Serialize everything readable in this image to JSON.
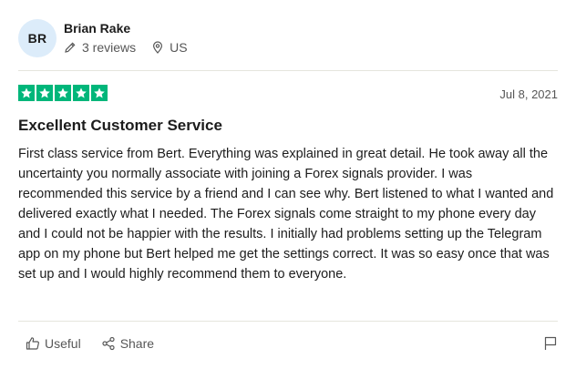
{
  "reviewer": {
    "initials": "BR",
    "name": "Brian Rake",
    "reviews_count": "3 reviews",
    "country": "US"
  },
  "review": {
    "rating": 5,
    "star_color": "#00b67a",
    "date": "Jul 8, 2021",
    "title": "Excellent Customer Service",
    "text": "First class service from Bert. Everything was explained in great detail. He took away all the uncertainty you normally associate with joining a Forex signals provider. I was recommended this service by a friend and I can see why. Bert listened to what I wanted and delivered exactly what I needed. The Forex signals come straight to my phone every day and I could not be happier with the results. I initially had problems setting up the Telegram app on my phone but Bert helped me get the settings correct. It was so easy once that was set up and I would highly recommend them to everyone."
  },
  "actions": {
    "useful_label": "Useful",
    "share_label": "Share",
    "icons": [
      "thumbs-up-icon",
      "share-icon",
      "flag-icon"
    ]
  }
}
